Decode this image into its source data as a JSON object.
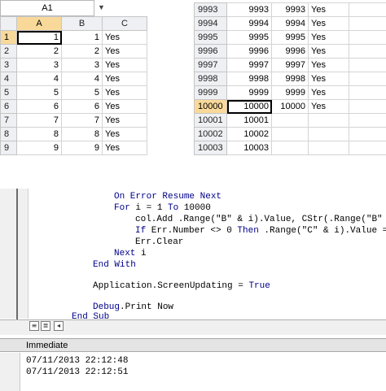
{
  "sheet_left": {
    "name_box": "A1",
    "columns": [
      "A",
      "B",
      "C"
    ],
    "rows": [
      {
        "row": "1",
        "a": "1",
        "b": "1",
        "c": "Yes"
      },
      {
        "row": "2",
        "a": "2",
        "b": "2",
        "c": "Yes"
      },
      {
        "row": "3",
        "a": "3",
        "b": "3",
        "c": "Yes"
      },
      {
        "row": "4",
        "a": "4",
        "b": "4",
        "c": "Yes"
      },
      {
        "row": "5",
        "a": "5",
        "b": "5",
        "c": "Yes"
      },
      {
        "row": "6",
        "a": "6",
        "b": "6",
        "c": "Yes"
      },
      {
        "row": "7",
        "a": "7",
        "b": "7",
        "c": "Yes"
      },
      {
        "row": "8",
        "a": "8",
        "b": "8",
        "c": "Yes"
      },
      {
        "row": "9",
        "a": "9",
        "b": "9",
        "c": "Yes"
      }
    ]
  },
  "sheet_right": {
    "rows": [
      {
        "row": "9993",
        "a": "9993",
        "b": "9993",
        "c": "Yes"
      },
      {
        "row": "9994",
        "a": "9994",
        "b": "9994",
        "c": "Yes"
      },
      {
        "row": "9995",
        "a": "9995",
        "b": "9995",
        "c": "Yes"
      },
      {
        "row": "9996",
        "a": "9996",
        "b": "9996",
        "c": "Yes"
      },
      {
        "row": "9997",
        "a": "9997",
        "b": "9997",
        "c": "Yes"
      },
      {
        "row": "9998",
        "a": "9998",
        "b": "9998",
        "c": "Yes"
      },
      {
        "row": "9999",
        "a": "9999",
        "b": "9999",
        "c": "Yes"
      },
      {
        "row": "10000",
        "a": "10000",
        "b": "10000",
        "c": "Yes"
      },
      {
        "row": "10001",
        "a": "10001",
        "b": "",
        "c": ""
      },
      {
        "row": "10002",
        "a": "10002",
        "b": "",
        "c": ""
      },
      {
        "row": "10003",
        "a": "10003",
        "b": "",
        "c": ""
      }
    ]
  },
  "code": {
    "line1_kw": "On Error Resume Next",
    "line2_kw1": "For",
    "line2_txt": " i = 1 ",
    "line2_kw2": "To",
    "line2_txt2": " 10000",
    "line3_txt": "col.Add .Range(\"B\" & i).Value, CStr(.Range(\"B\" &",
    "line4_kw1": "If",
    "line4_txt": " Err.Number <> 0 ",
    "line4_kw2": "Then",
    "line4_txt2": " .Range(\"C\" & i).Value =",
    "line5_txt": "Err.Clear",
    "line6_kw": "Next",
    "line6_txt": " i",
    "line7_kw": "End With",
    "line8_txt": "Application.ScreenUpdating = ",
    "line8_kw": "True",
    "line9_kw": "Debug",
    "line9_txt": ".Print Now",
    "line10_kw": "End Sub"
  },
  "immediate": {
    "title": "Immediate",
    "lines": [
      "07/11/2013 22:12:48",
      "07/11/2013 22:12:51"
    ]
  },
  "colors": {
    "keyword": "#00008b",
    "selected_header": "#f9d99a"
  }
}
